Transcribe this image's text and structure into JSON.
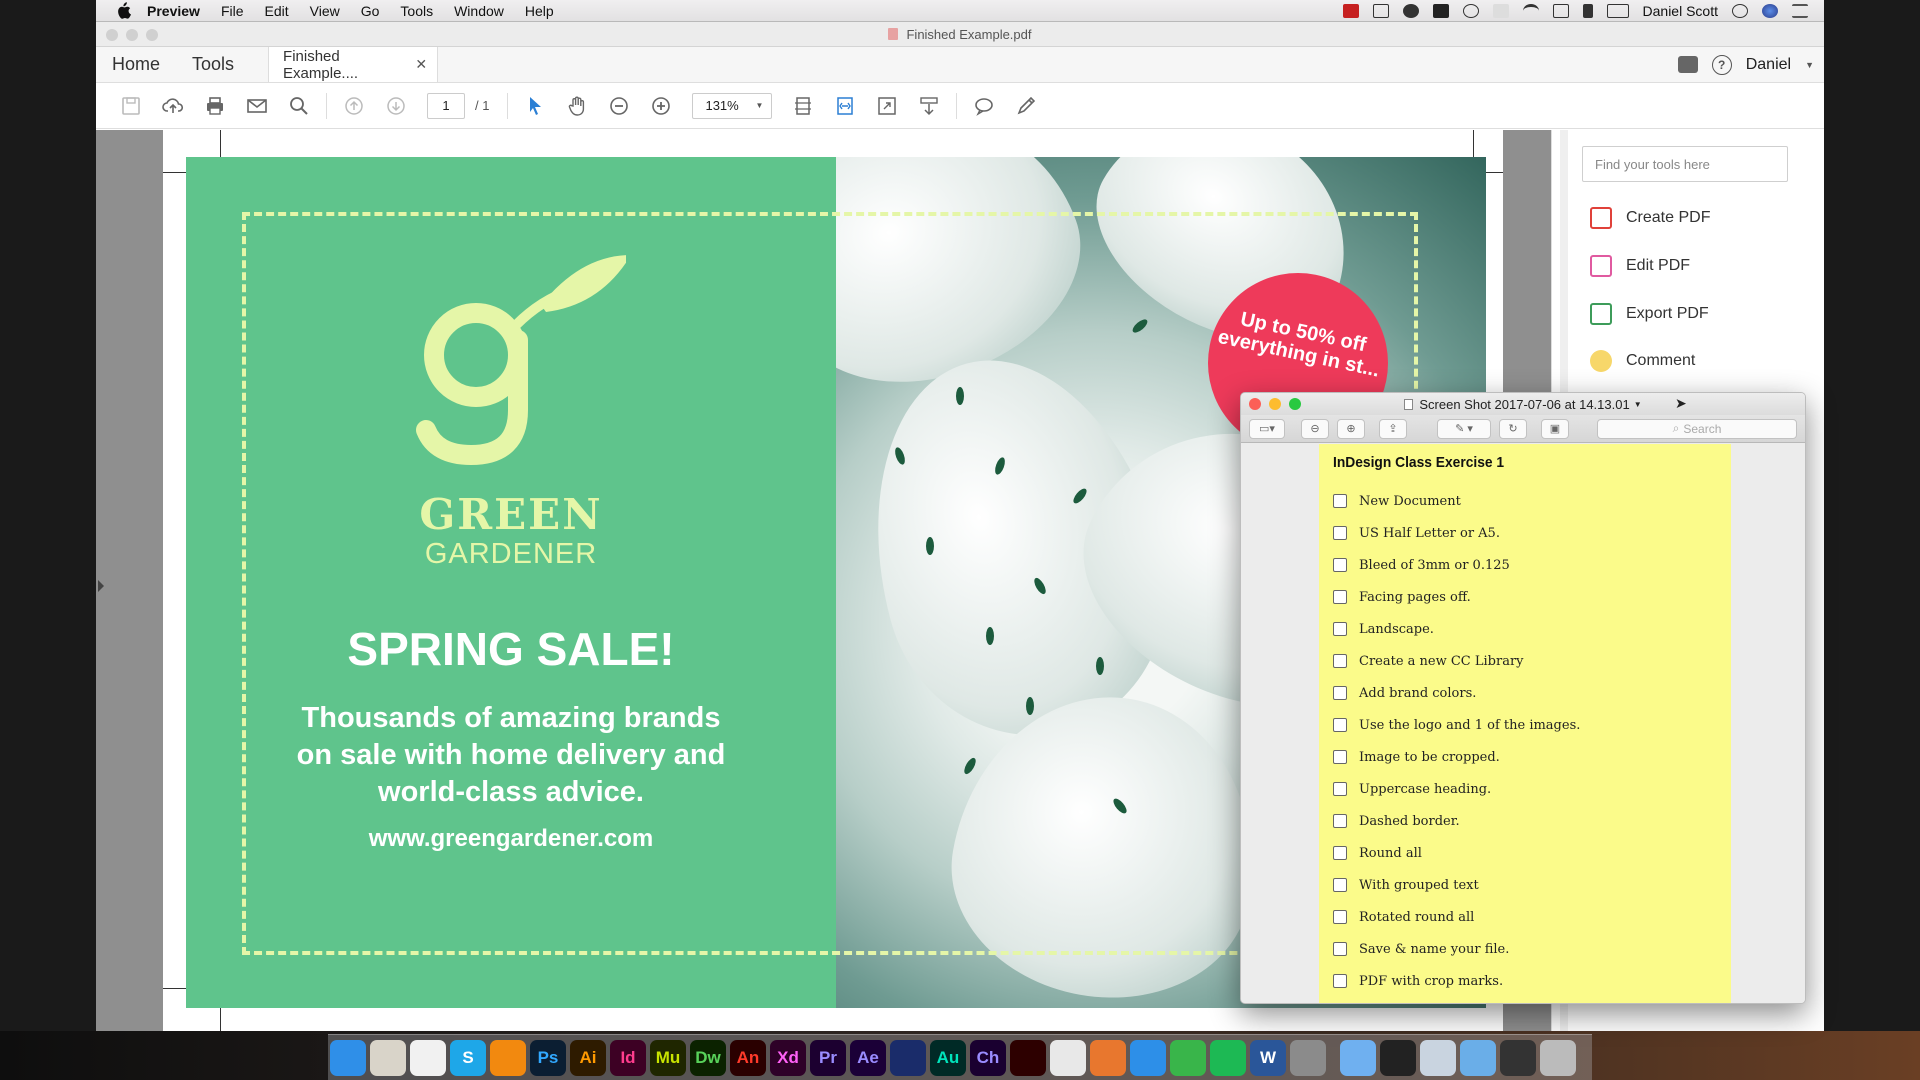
{
  "menubar": {
    "app_name": "Preview",
    "menus": [
      "File",
      "Edit",
      "View",
      "Go",
      "Tools",
      "Window",
      "Help"
    ],
    "user": "Daniel Scott"
  },
  "acrobat": {
    "window_title": "Finished Example.pdf",
    "nav_tabs": [
      "Home",
      "Tools"
    ],
    "doc_tab": "Finished Example....",
    "user": "Daniel",
    "page_current": "1",
    "page_total": "/ 1",
    "zoom": "131%",
    "tools_search_placeholder": "Find your tools here",
    "tools": [
      {
        "label": "Create PDF",
        "icon": "create-pdf-icon",
        "color": "#e0413a"
      },
      {
        "label": "Edit PDF",
        "icon": "edit-pdf-icon",
        "color": "#e05aa0"
      },
      {
        "label": "Export PDF",
        "icon": "export-pdf-icon",
        "color": "#3d9c5a"
      },
      {
        "label": "Comment",
        "icon": "comment-icon",
        "color": "#f1c232"
      }
    ]
  },
  "flyer": {
    "brand_line1": "GREEN",
    "brand_line2": "GARDENER",
    "headline": "SPRING SALE!",
    "subtext": "Thousands of amazing brands on sale with home delivery and world-class advice.",
    "url": "www.greengardener.com",
    "badge": "Up to 50% off everything in st...",
    "colors": {
      "green": "#5fc48c",
      "lime": "#e5f6a8",
      "badge": "#ee3a5a"
    }
  },
  "preview_window": {
    "title": "Screen Shot 2017-07-06 at 14.13.01",
    "search_placeholder": "Search",
    "note_title": "InDesign Class Exercise 1",
    "checklist": [
      "New Document",
      "US Half Letter or A5.",
      "Bleed of 3mm or 0.125",
      "Facing pages off.",
      "Landscape.",
      "Create a new CC Library",
      "Add brand colors.",
      "Use the logo and 1 of the images.",
      "Image to be cropped.",
      "Uppercase heading.",
      "Dashed border.",
      "Round all",
      "With grouped text",
      "Rotated round all",
      "Save & name your file.",
      "PDF with crop marks."
    ]
  },
  "dock": {
    "apps": [
      {
        "label": "",
        "name": "finder",
        "bg": "#2f8fe8",
        "fg": "#fff"
      },
      {
        "label": "",
        "name": "notes-app",
        "bg": "#d9d4c9",
        "fg": "#333"
      },
      {
        "label": "",
        "name": "textedit",
        "bg": "#f1f1f1",
        "fg": "#333"
      },
      {
        "label": "S",
        "name": "skype",
        "bg": "#1ea7e8",
        "fg": "#fff"
      },
      {
        "label": "",
        "name": "vlc",
        "bg": "#f2890f",
        "fg": "#fff"
      },
      {
        "label": "Ps",
        "name": "photoshop",
        "bg": "#0b1e32",
        "fg": "#31a8ff"
      },
      {
        "label": "Ai",
        "name": "illustrator",
        "bg": "#2e1b00",
        "fg": "#ff9a00"
      },
      {
        "label": "Id",
        "name": "indesign",
        "bg": "#3d0124",
        "fg": "#ff3d8e"
      },
      {
        "label": "Mu",
        "name": "muse",
        "bg": "#1f2600",
        "fg": "#c8e300"
      },
      {
        "label": "Dw",
        "name": "dreamweaver",
        "bg": "#0b2200",
        "fg": "#58d25a"
      },
      {
        "label": "An",
        "name": "animate",
        "bg": "#2a0000",
        "fg": "#ff3a2a"
      },
      {
        "label": "Xd",
        "name": "xd",
        "bg": "#2e0128",
        "fg": "#ff61f6"
      },
      {
        "label": "Pr",
        "name": "premiere",
        "bg": "#1c0030",
        "fg": "#9a8cff"
      },
      {
        "label": "Ae",
        "name": "after-effects",
        "bg": "#1b0037",
        "fg": "#9a8cff"
      },
      {
        "label": "",
        "name": "imovie",
        "bg": "#1a2c6a",
        "fg": "#fff"
      },
      {
        "label": "Au",
        "name": "audition",
        "bg": "#002a26",
        "fg": "#00e4bb"
      },
      {
        "label": "Ch",
        "name": "character-animator",
        "bg": "#1a0030",
        "fg": "#9a8cff"
      },
      {
        "label": "",
        "name": "acrobat",
        "bg": "#2d0000",
        "fg": "#ff3a2a"
      },
      {
        "label": "",
        "name": "chrome",
        "bg": "#e8e8e8",
        "fg": "#333"
      },
      {
        "label": "",
        "name": "firefox",
        "bg": "#e8772e",
        "fg": "#fff"
      },
      {
        "label": "",
        "name": "safari",
        "bg": "#2d8fe8",
        "fg": "#fff"
      },
      {
        "label": "",
        "name": "facetime",
        "bg": "#39b54a",
        "fg": "#fff"
      },
      {
        "label": "",
        "name": "spotify",
        "bg": "#1db954",
        "fg": "#111"
      },
      {
        "label": "W",
        "name": "word",
        "bg": "#2a5699",
        "fg": "#fff"
      },
      {
        "label": "",
        "name": "system-preferences",
        "bg": "#8b8b8b",
        "fg": "#fff"
      },
      {
        "label": "",
        "name": "messages",
        "bg": "#6fb0f0",
        "fg": "#fff"
      },
      {
        "label": "",
        "name": "activity-monitor",
        "bg": "#222",
        "fg": "#7ee07e"
      },
      {
        "label": "",
        "name": "preview-app",
        "bg": "#c9d4e0",
        "fg": "#333"
      },
      {
        "label": "",
        "name": "downloads-folder",
        "bg": "#6aaee8",
        "fg": "#fff"
      },
      {
        "label": "",
        "name": "terminal",
        "bg": "#333",
        "fg": "#fff"
      },
      {
        "label": "",
        "name": "trash",
        "bg": "#bbbbbb",
        "fg": "#555"
      }
    ]
  }
}
